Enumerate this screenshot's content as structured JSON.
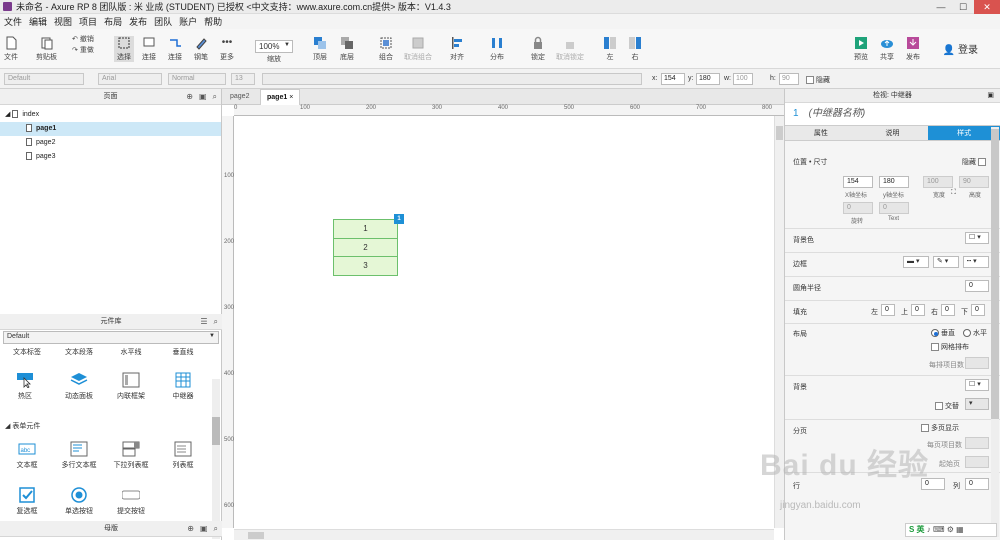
{
  "window": {
    "title": "未命名 - Axure RP 8 团队版 : 米 业成 (STUDENT) 已授权    <中文支持：www.axure.com.cn提供> 版本：V1.4.3"
  },
  "menu": [
    "文件",
    "编辑",
    "视图",
    "项目",
    "布局",
    "发布",
    "团队",
    "账户",
    "帮助"
  ],
  "toolbar": {
    "file": "文件",
    "clipboard": "剪贴板",
    "undo": "撤销",
    "redo": "重做",
    "select": "选择",
    "connect": "连接",
    "pen": "钢笔",
    "more": "更多",
    "zoom_value": "100%",
    "zoom": "缩放",
    "top": "顶层",
    "bottom": "底层",
    "group": "组合",
    "ungroup": "取消组合",
    "align": "对齐",
    "distribute": "分布",
    "lock": "锁定",
    "unlock": "取消锁定",
    "left": "左",
    "right": "右",
    "preview": "预览",
    "share": "共享",
    "publish": "发布",
    "login": "登录"
  },
  "format": {
    "style": "Default",
    "font": "Arial",
    "weight": "Normal",
    "size": "13",
    "x_label": "x:",
    "x": "154",
    "y_label": "y:",
    "y": "180",
    "w_label": "w:",
    "w": "100",
    "h_label": "h:",
    "h": "90",
    "hidden": "隐藏"
  },
  "pages": {
    "header": "页面",
    "root": "index",
    "items": [
      "page1",
      "page2",
      "page3"
    ]
  },
  "library": {
    "header": "元件库",
    "selected": "Default",
    "top_row": [
      "文本标签",
      "文本段落",
      "水平线",
      "垂直线"
    ],
    "row1": [
      "热区",
      "动态面板",
      "内联框架",
      "中继器"
    ],
    "section": "表单元件",
    "row2": [
      "文本框",
      "多行文本框",
      "下拉列表框",
      "列表框"
    ],
    "row3": [
      "复选框",
      "单选按钮",
      "提交按钮"
    ],
    "footer": "母版"
  },
  "canvas": {
    "tabs": [
      "page2",
      "page1"
    ],
    "ruler_h": [
      "0",
      "100",
      "200",
      "300",
      "400",
      "500",
      "600",
      "700",
      "800"
    ],
    "ruler_v": [
      "100",
      "200",
      "300",
      "400",
      "500",
      "600"
    ],
    "rows": [
      "1",
      "2",
      "3"
    ],
    "badge": "1"
  },
  "inspector": {
    "header": "检视: 中继器",
    "num": "1",
    "name_placeholder": "(中继器名称)",
    "tabs": [
      "属性",
      "说明",
      "样式"
    ],
    "pos_size": "位置 • 尺寸",
    "hidden": "隐藏",
    "x": "154",
    "y": "180",
    "w": "100",
    "h": "90",
    "x_label": "X轴坐标",
    "y_label": "y轴坐标",
    "w_label": "宽度",
    "h_label": "高度",
    "rot": "0",
    "text_rot": "0",
    "rot_label": "旋转",
    "text_label": "Text",
    "bg_color": "背景色",
    "border": "边框",
    "radius": "圆角半径",
    "radius_val": "0",
    "padding": "填充",
    "pad_left": "左",
    "pad_top": "上",
    "pad_right": "右",
    "pad_bottom": "下",
    "pad_val": "0",
    "layout": "布局",
    "vertical": "垂直",
    "horizontal": "水平",
    "grid": "网格排布",
    "items_per_row": "每排项目数",
    "background": "背景",
    "alternate": "交替",
    "paging": "分页",
    "multi_page": "多页显示",
    "items_per_page": "每页项目数",
    "start_page": "起始页",
    "row_label": "行",
    "col_label": "列",
    "zero": "0"
  },
  "watermark": {
    "main": "Bai du 经验",
    "sub": "jingyan.baidu.com"
  },
  "ime": "S 英"
}
